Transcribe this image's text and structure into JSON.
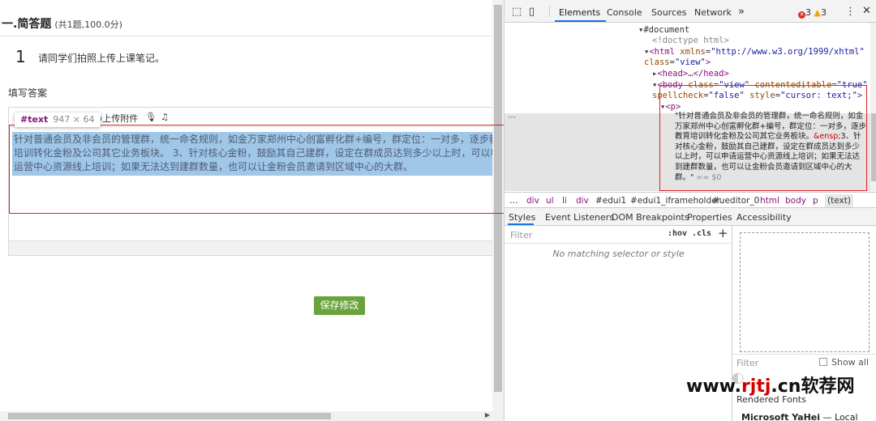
{
  "exam": {
    "section_title": "一.简答题",
    "section_meta": "(共1题,100.0分)",
    "question_number": "1",
    "question_text": "请同学们拍照上传上课笔记。",
    "answer_label": "填写答案",
    "answer_text": "针对普通会员及非会员的管理群，统一命名规则，如金万家郑州中心创富孵化群+编号，群定位：一对多，逐步教育培训转化金粉及公司其它业务板块。 3、针对核心金粉，鼓励其自己建群，设定在群成员达到多少以上时，可以申请运营中心资源线上培训；如果无法达到建群数量，也可以让金粉会员邀请到区域中心的大群。",
    "save_label": "保存修改"
  },
  "editor_toolbar": {
    "tooltip_tag": "#text",
    "tooltip_size": "947 × 64",
    "attach_label": "上传附件"
  },
  "devtools": {
    "tabs": [
      "Elements",
      "Console",
      "Sources",
      "Network"
    ],
    "more_tabs": "»",
    "error_count": "3",
    "warning_count": "3",
    "dom": {
      "document": "#document",
      "doctype": "<!doctype html>",
      "html_open": "<html",
      "html_attr": "xmlns",
      "html_attr_val": "\"http://www.w3.org/1999/xhtml\"",
      "html_class_attr": "class",
      "html_class_val": "\"view\"",
      "head": "<head>…</head>",
      "body_open": "<body",
      "body_class_attr": "class",
      "body_class_val": "\"view\"",
      "body_ce_attr": "contenteditable",
      "body_ce_val": "\"true\"",
      "body_sc_attr": "spellcheck",
      "body_sc_val": "\"false\"",
      "body_style_attr": "style",
      "body_style_val": "\"cursor: text;\"",
      "p_open": "<p>",
      "text_node_part1": "\"针对普通会员及非会员的管理群，统一命名规则，如金万家郑州中心创富孵化群+编号，群定位：一对多，逐步教育培训转化金粉及公司其它业务板块。",
      "text_node_entity": "&ensp;",
      "text_node_part2": "3、针对核心金粉，鼓励其自己建群，设定在群成员达到多少以上时，可以申请运营中心资源线上培训；如果无法达到建群数量，也可以让金粉会员邀请到区域中心的大群。\"",
      "text_node_eq": "== $0"
    },
    "breadcrumbs": [
      "…",
      "div",
      "ul",
      "li",
      "div",
      "#edui1",
      "#edui1_iframeholder",
      "#ueditor_0",
      "html",
      "body",
      "p",
      "(text)"
    ],
    "sub_tabs": [
      "Styles",
      "Event Listeners",
      "DOM Breakpoints",
      "Properties",
      "Accessibility"
    ],
    "styles_filter_placeholder": "Filter",
    "hov_label": ":hov",
    "cls_label": ".cls",
    "plus_label": "+",
    "no_match_text": "No matching selector or style",
    "computed_filter_placeholder": "Filter",
    "show_all_label": "Show all",
    "rendered_fonts_label": "Rendered Fonts",
    "font_name": "Microsoft YaHei",
    "font_source": "— Local"
  },
  "watermark": {
    "prefix": "www.",
    "mid": "rjtj",
    "suffix": ".cn",
    "brand": "软荐网"
  },
  "colors": {
    "save_button": "#6aa33b",
    "selection": "#6fa8dc",
    "annotation_red": "#e02020",
    "devtools_accent": "#1a73e8",
    "dom_tag": "#881280",
    "dom_attr": "#994500",
    "dom_value": "#1a1aa6"
  }
}
